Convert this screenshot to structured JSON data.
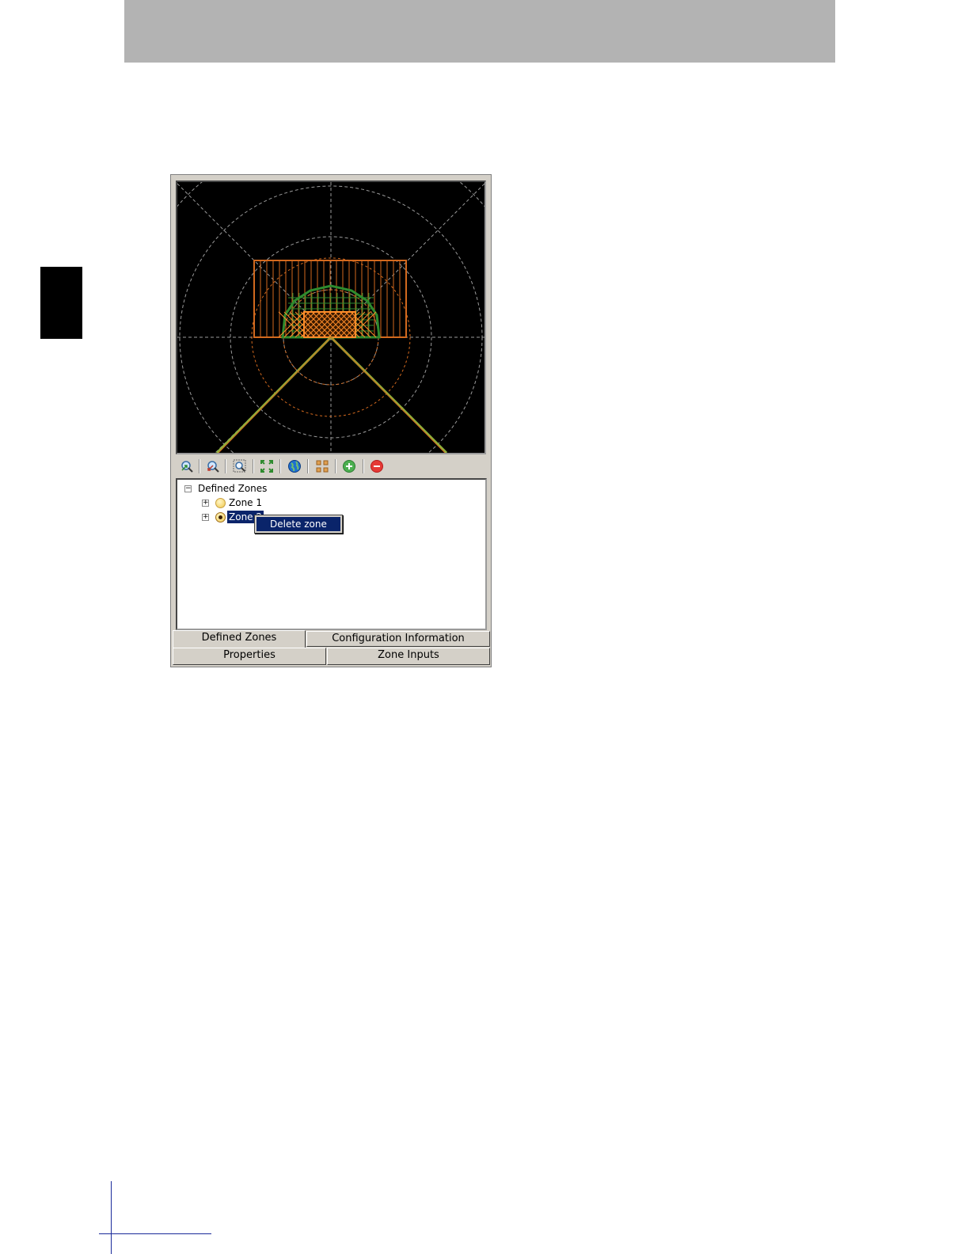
{
  "tree": {
    "root_label": "Defined Zones",
    "root_expander": "−",
    "zones": [
      {
        "label": "Zone 1",
        "expander": "+",
        "selected": false
      },
      {
        "label": "Zone 2",
        "expander": "+",
        "selected": true
      }
    ]
  },
  "context_menu": {
    "items": [
      "Delete zone"
    ]
  },
  "tabs": {
    "row1": [
      "Defined Zones",
      "Configuration Information"
    ],
    "row2": [
      "Properties",
      "Zone Inputs"
    ],
    "active": "Defined Zones"
  },
  "toolbar": {
    "icons": [
      "zoom-in-icon",
      "zoom-out-icon",
      "zoom-window-icon",
      "fit-to-view-icon",
      "globe-icon",
      "grid-points-icon",
      "add-zone-icon",
      "remove-zone-icon"
    ]
  },
  "colors": {
    "view_background": "#000000",
    "grid": "#9a9a9a",
    "warning_zone": "#d2691e",
    "safety_zone": "#2e8b2e",
    "detection_field": "#8fb03a",
    "selection": "#0a246a",
    "header_band": "#b3b3b3"
  }
}
